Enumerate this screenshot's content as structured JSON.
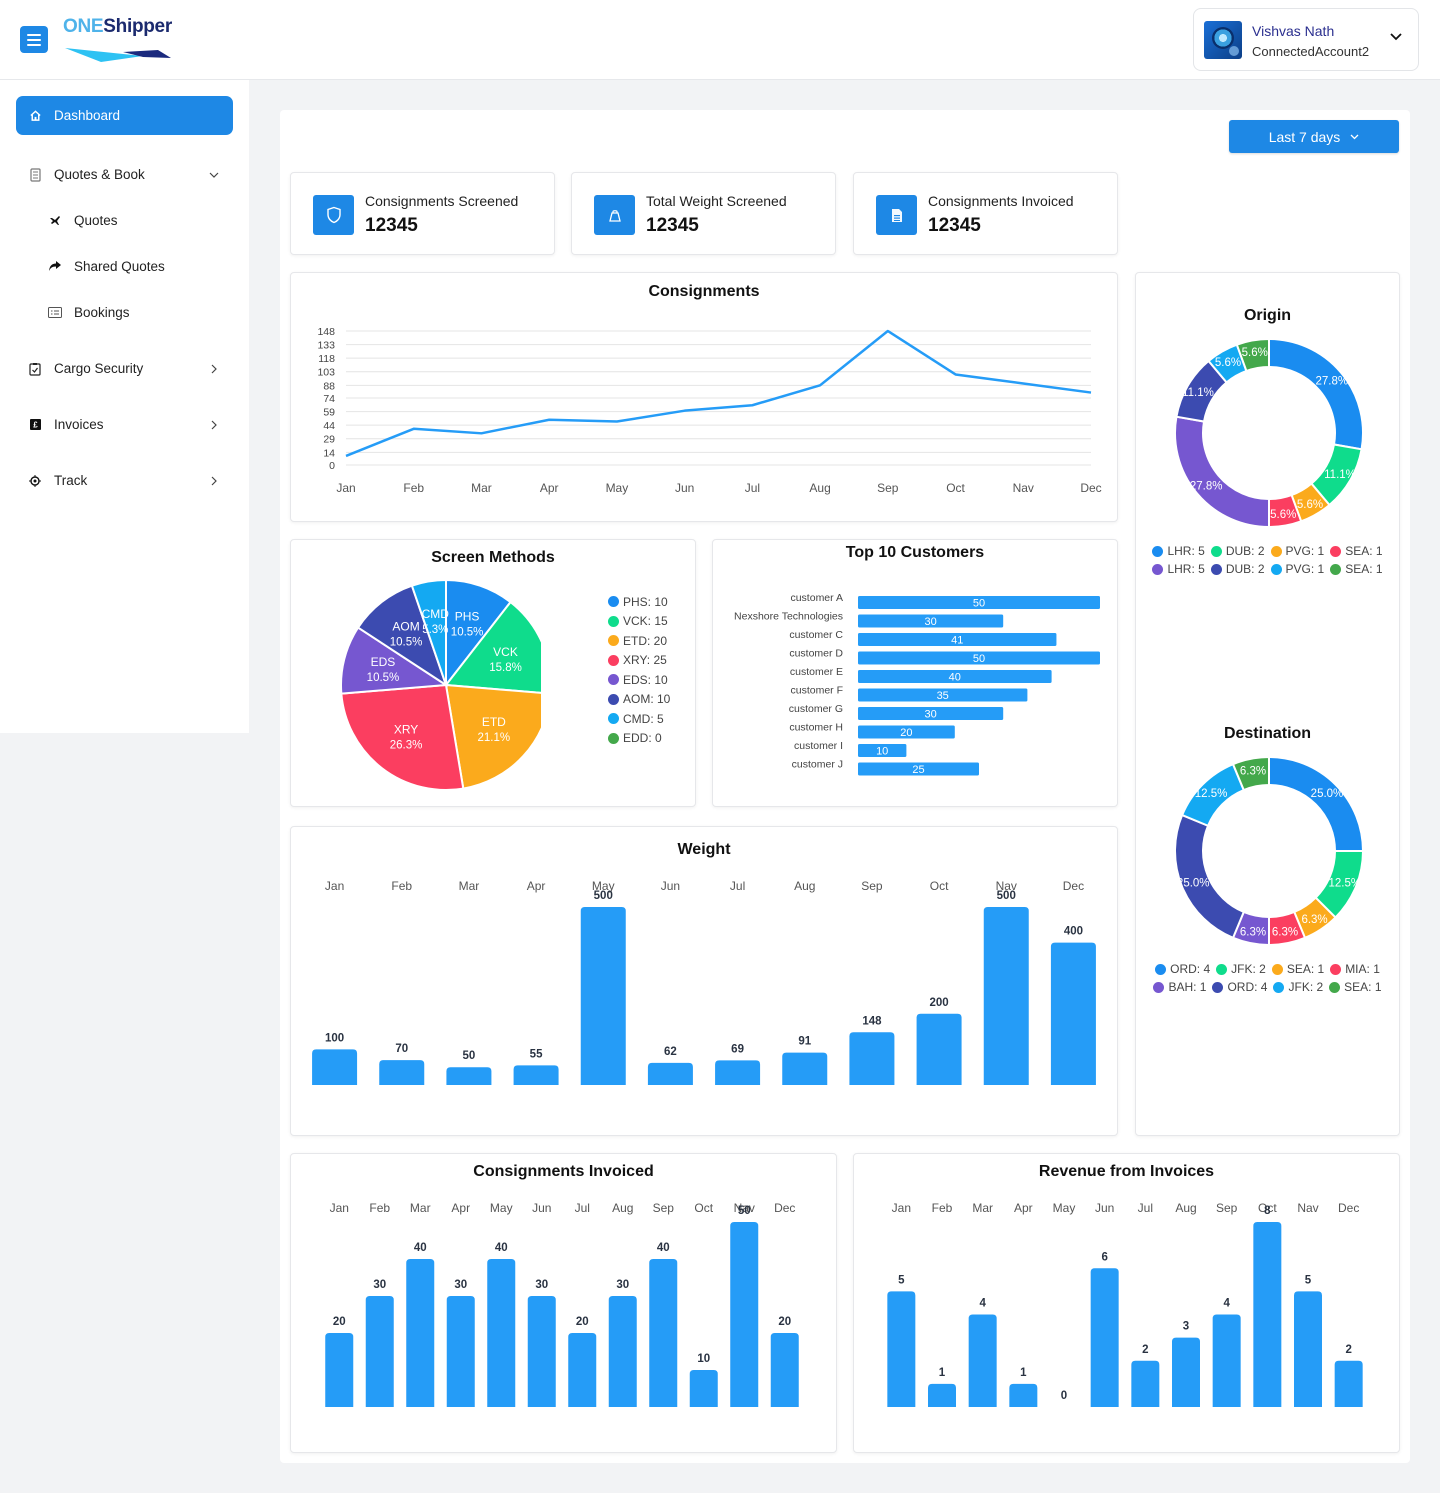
{
  "header": {
    "logo_one": "ONE",
    "logo_shipper": "Shipper",
    "menu_icon": "hamburger-icon",
    "account": {
      "name": "Vishvas Nath",
      "sub": "ConnectedAccount2",
      "chevron_icon": "chevron-down-icon"
    }
  },
  "sidebar": {
    "items": [
      {
        "label": "Dashboard",
        "icon": "home-icon",
        "active": true
      },
      {
        "label": "Quotes & Book",
        "icon": "document-icon",
        "expanded": true
      },
      {
        "label": "Quotes",
        "icon": "airplane-icon",
        "sub": true
      },
      {
        "label": "Shared Quotes",
        "icon": "share-arrow-icon",
        "sub": true
      },
      {
        "label": "Bookings",
        "icon": "list-card-icon",
        "sub": true
      },
      {
        "label": "Cargo Security",
        "icon": "clipboard-check-icon"
      },
      {
        "label": "Invoices",
        "icon": "pound-icon"
      },
      {
        "label": "Track",
        "icon": "target-icon"
      }
    ]
  },
  "toolbar": {
    "period_label": "Last 7 days"
  },
  "stats": [
    {
      "label": "Consignments Screened",
      "value": "12345",
      "icon": "shield-icon"
    },
    {
      "label": "Total Weight Screened",
      "value": "12345",
      "icon": "weight-icon"
    },
    {
      "label": "Consignments Invoiced",
      "value": "12345",
      "icon": "invoice-icon"
    }
  ],
  "colors": {
    "accent": "#1e88e5",
    "bar": "#259cf7"
  },
  "chart_data": [
    {
      "id": "consignments",
      "type": "line",
      "title": "Consignments",
      "categories": [
        "Jan",
        "Feb",
        "Mar",
        "Apr",
        "May",
        "Jun",
        "Jul",
        "Aug",
        "Sep",
        "Oct",
        "Nav",
        "Dec"
      ],
      "values": [
        10,
        40,
        35,
        50,
        48,
        60,
        66,
        88,
        148,
        100,
        90,
        80
      ],
      "yticks": [
        0,
        14,
        29,
        44,
        59,
        74,
        88,
        103,
        118,
        133,
        148
      ],
      "ylim": [
        0,
        148
      ],
      "grid": true,
      "color": "#259cf7"
    },
    {
      "id": "screen_methods",
      "type": "pie",
      "title": "Screen Methods",
      "legend_position": "right",
      "slices": [
        {
          "label": "PHS",
          "value": 10,
          "pct": "10.5%",
          "color": "#1a8cf0"
        },
        {
          "label": "VCK",
          "value": 15,
          "pct": "15.8%",
          "color": "#0fdc8c"
        },
        {
          "label": "ETD",
          "value": 20,
          "pct": "21.1%",
          "color": "#fbaa1c"
        },
        {
          "label": "XRY",
          "value": 25,
          "pct": "26.3%",
          "color": "#fb3e60"
        },
        {
          "label": "EDS",
          "value": 10,
          "pct": "10.5%",
          "color": "#7657d0"
        },
        {
          "label": "AOM",
          "value": 10,
          "pct": "10.5%",
          "color": "#3c4bb0"
        },
        {
          "label": "CMD",
          "value": 5,
          "pct": "5.3%",
          "color": "#14a9f2"
        },
        {
          "label": "EDD",
          "value": 0,
          "pct": "",
          "color": "#43a84b"
        }
      ]
    },
    {
      "id": "top_customers",
      "type": "bar",
      "orientation": "horizontal",
      "title": "Top 10 Customers",
      "categories": [
        "customer A",
        "Nexshore Technologies",
        "customer C",
        "customer D",
        "customer E",
        "customer F",
        "customer G",
        "customer H",
        "customer I",
        "customer J"
      ],
      "values": [
        50,
        30,
        41,
        50,
        40,
        35,
        30,
        20,
        10,
        25
      ],
      "xlim": [
        0,
        50
      ]
    },
    {
      "id": "origin",
      "type": "pie",
      "variant": "donut",
      "title": "Origin",
      "legend_position": "bottom",
      "slices": [
        {
          "label": "LHR",
          "value": 5,
          "pct": "27.8%",
          "color": "#1a8cf0"
        },
        {
          "label": "DUB",
          "value": 2,
          "pct": "11.1%",
          "color": "#0fdc8c"
        },
        {
          "label": "PVG",
          "value": 1,
          "pct": "5.6%",
          "color": "#fbaa1c"
        },
        {
          "label": "SEA",
          "value": 1,
          "pct": "5.6%",
          "color": "#fb3e60"
        },
        {
          "label": "LHR",
          "value": 5,
          "pct": "27.8%",
          "color": "#7657d0"
        },
        {
          "label": "DUB",
          "value": 2,
          "pct": "11.1%",
          "color": "#3c4bb0"
        },
        {
          "label": "PVG",
          "value": 1,
          "pct": "5.6%",
          "color": "#14a9f2"
        },
        {
          "label": "SEA",
          "value": 1,
          "pct": "5.6%",
          "color": "#43a84b"
        }
      ]
    },
    {
      "id": "destination",
      "type": "pie",
      "variant": "donut",
      "title": "Destination",
      "legend_position": "bottom",
      "slices": [
        {
          "label": "ORD",
          "value": 4,
          "pct": "25.0%",
          "color": "#1a8cf0"
        },
        {
          "label": "JFK",
          "value": 2,
          "pct": "12.5%",
          "color": "#0fdc8c"
        },
        {
          "label": "SEA",
          "value": 1,
          "pct": "6.3%",
          "color": "#fbaa1c"
        },
        {
          "label": "MIA",
          "value": 1,
          "pct": "6.3%",
          "color": "#fb3e60"
        },
        {
          "label": "BAH",
          "value": 1,
          "pct": "6.3%",
          "color": "#7657d0"
        },
        {
          "label": "ORD",
          "value": 4,
          "pct": "25.0%",
          "color": "#3c4bb0"
        },
        {
          "label": "JFK",
          "value": 2,
          "pct": "12.5%",
          "color": "#14a9f2"
        },
        {
          "label": "SEA",
          "value": 1,
          "pct": "6.3%",
          "color": "#43a84b"
        }
      ]
    },
    {
      "id": "weight",
      "type": "bar",
      "title": "Weight",
      "categories": [
        "Jan",
        "Feb",
        "Mar",
        "Apr",
        "May",
        "Jun",
        "Jul",
        "Aug",
        "Sep",
        "Oct",
        "Nav",
        "Dec"
      ],
      "values": [
        100,
        70,
        50,
        55,
        500,
        62,
        69,
        91,
        148,
        200,
        500,
        400
      ],
      "ylim": [
        0,
        500
      ]
    },
    {
      "id": "consignments_invoiced",
      "type": "bar",
      "title": "Consignments Invoiced",
      "categories": [
        "Jan",
        "Feb",
        "Mar",
        "Apr",
        "May",
        "Jun",
        "Jul",
        "Aug",
        "Sep",
        "Oct",
        "Nav",
        "Dec"
      ],
      "values": [
        20,
        30,
        40,
        30,
        40,
        30,
        20,
        30,
        40,
        10,
        50,
        20
      ],
      "ylim": [
        0,
        50
      ]
    },
    {
      "id": "revenue_invoices",
      "type": "bar",
      "title": "Revenue from Invoices",
      "categories": [
        "Jan",
        "Feb",
        "Mar",
        "Apr",
        "May",
        "Jun",
        "Jul",
        "Aug",
        "Sep",
        "Oct",
        "Nav",
        "Dec"
      ],
      "values": [
        5,
        1,
        4,
        1,
        0,
        6,
        2,
        3,
        4,
        8,
        5,
        2
      ],
      "ylim": [
        0,
        8
      ]
    }
  ]
}
